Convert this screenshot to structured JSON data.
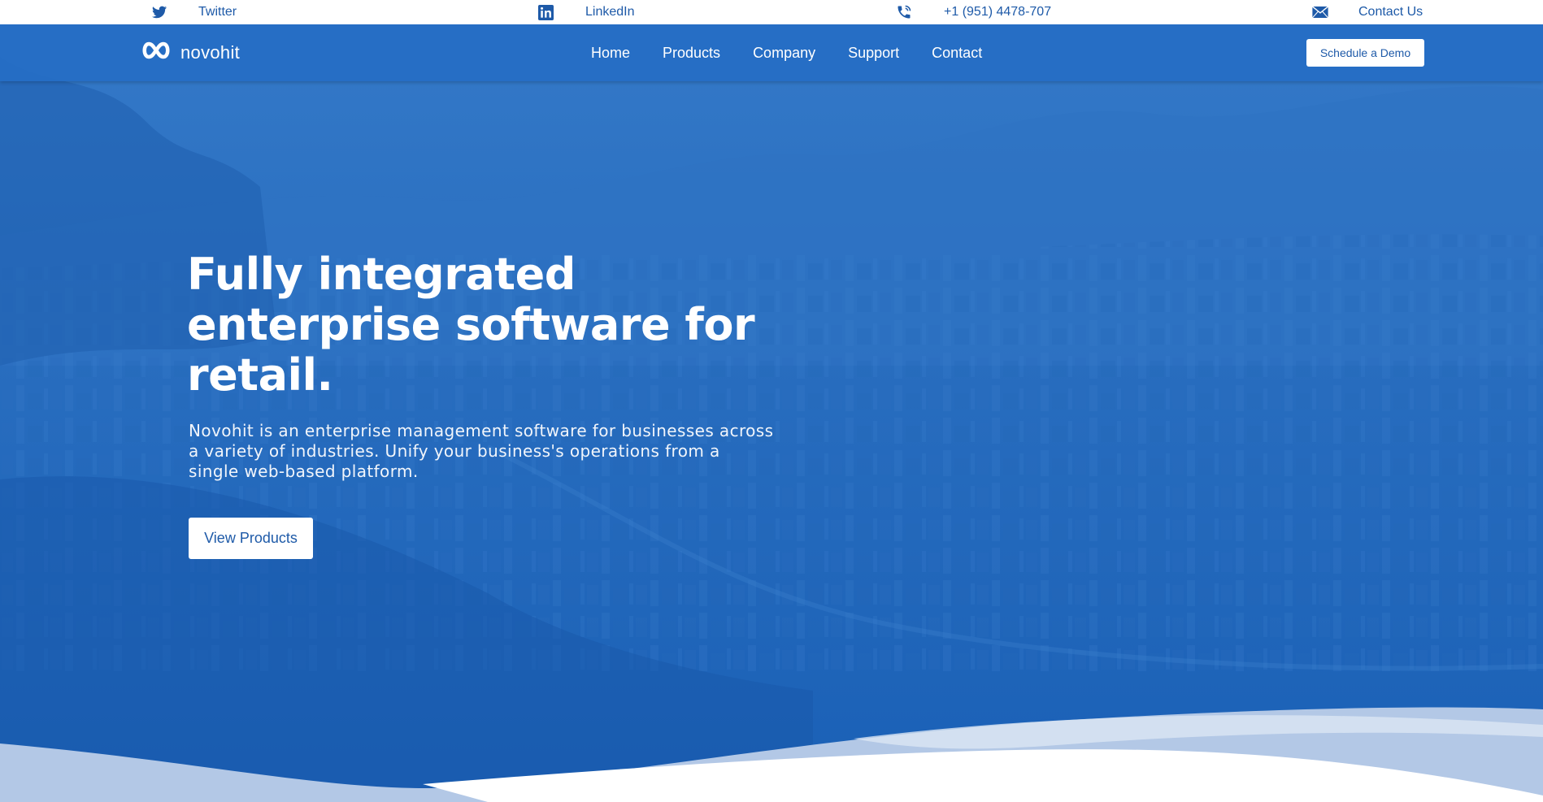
{
  "topbar": {
    "twitter": {
      "icon": "twitter-icon",
      "label": "Twitter"
    },
    "linkedin": {
      "icon": "linkedin-icon",
      "label": "LinkedIn"
    },
    "phone": {
      "icon": "phone-icon",
      "label": "+1 (951) 4478-707"
    },
    "contact": {
      "icon": "mail-icon",
      "label": "Contact Us"
    }
  },
  "header": {
    "logo_text": "novohit",
    "logo_icon": "infinity-logo-icon",
    "nav": [
      "Home",
      "Products",
      "Company",
      "Support",
      "Contact"
    ],
    "demo_button": "Schedule a Demo"
  },
  "hero": {
    "headline_line1": "Fully integrated",
    "headline_line2": "enterprise software for",
    "headline_line3": "retail.",
    "subtext_line1": "Novohit is an enterprise management software for businesses across",
    "subtext_line2": "a variety of industries. Unify your business's operations from a",
    "subtext_line3": "single web-based platform.",
    "cta_button": "View Products"
  },
  "colors": {
    "brand_blue": "#1c64b8",
    "nav_blue": "#256ec4",
    "text_blue": "#1e5aa8",
    "white": "#ffffff"
  }
}
